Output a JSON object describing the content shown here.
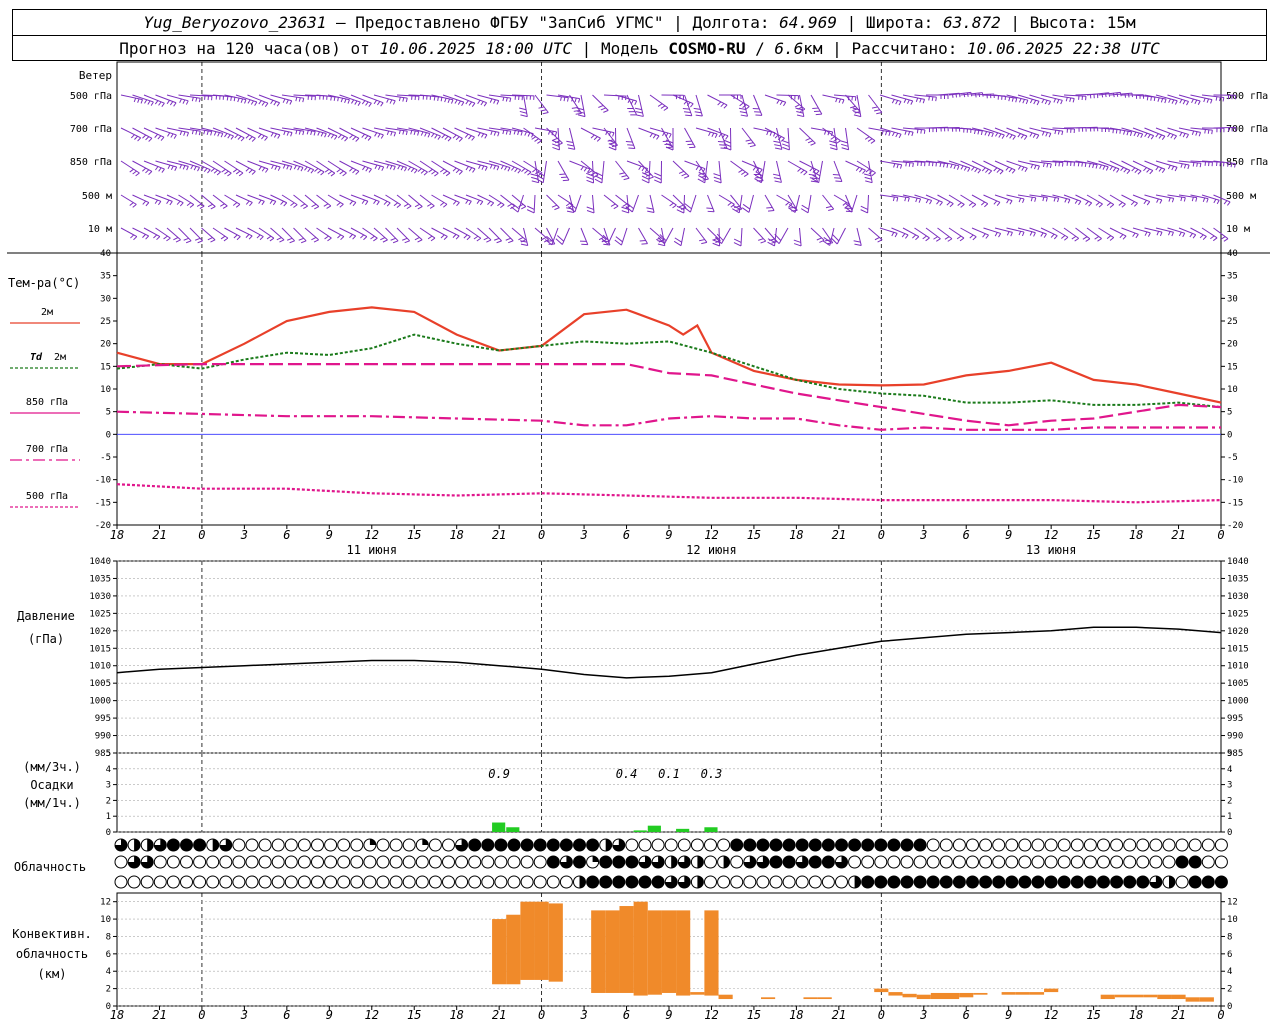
{
  "header": {
    "station": "Yug_Beryozovo_23631",
    "dash": " – ",
    "provider": "Предоставлено ФГБУ \"ЗапСиб УГМС\"",
    "lon_label": "Долгота:",
    "lon_value": "64.969",
    "lat_label": "Широта:",
    "lat_value": "63.872",
    "alt_label": "Высота:",
    "alt_value": "15м",
    "forecast_prefix": "Прогноз на 120 часа(ов) от",
    "forecast_time": "10.06.2025 18:00 UTC",
    "model_label": "Модель",
    "model_name": "COSMO-RU",
    "model_res": "6.6",
    "model_res_unit": "км",
    "calc_label": "Рассчитано:",
    "calc_time": "10.06.2025 22:38 UTC"
  },
  "time_axis": {
    "tick_labels": [
      "18",
      "21",
      "0",
      "3",
      "6",
      "9",
      "12",
      "15",
      "18",
      "21",
      "0",
      "3",
      "6",
      "9",
      "12",
      "15",
      "18",
      "21",
      "0",
      "3",
      "6",
      "9",
      "12",
      "15",
      "18",
      "21",
      "0"
    ],
    "day_labels": [
      {
        "text": "11 июня",
        "hour": 18
      },
      {
        "text": "12 июня",
        "hour": 42
      },
      {
        "text": "13 июня",
        "hour": 66
      }
    ],
    "midnight_hours": [
      6,
      30,
      54
    ]
  },
  "wind_panel": {
    "title": "Ветер",
    "levels": [
      "500 гПа",
      "700 гПа",
      "850 гПа",
      "500 м",
      "10  м"
    ]
  },
  "temp_panel": {
    "title": "Тем-ра(°C)",
    "legend": [
      {
        "label": "2м",
        "color": "#e8402a",
        "dash": ""
      },
      {
        "label": "2м",
        "prefix": "Td",
        "color": "#1a7a1a",
        "dash": "3,2"
      },
      {
        "label": "850 гПа",
        "color": "#e0168c",
        "dash": ""
      },
      {
        "label": "700 гПа",
        "color": "#e0168c",
        "dash": "12,4,3,4"
      },
      {
        "label": "500 гПа",
        "color": "#e0168c",
        "dash": "3,2"
      }
    ],
    "yticks": [
      "40",
      "35",
      "30",
      "25",
      "20",
      "15",
      "10",
      "5",
      "0",
      "-5",
      "-10",
      "-15",
      "-20"
    ]
  },
  "pressure_panel": {
    "title": "Давление",
    "unit": "(гПа)",
    "yticks": [
      "1040",
      "1035",
      "1030",
      "1025",
      "1020",
      "1015",
      "1010",
      "1005",
      "1000",
      "995",
      "990",
      "985"
    ]
  },
  "precip_panel": {
    "unit3": "(мм/3ч.)",
    "title": "Осадки",
    "unit1": "(мм/1ч.)",
    "yticks": [
      "5",
      "4",
      "3",
      "2",
      "1",
      "0"
    ],
    "annotations": [
      {
        "text": "0.9",
        "hour": 27
      },
      {
        "text": "0.4",
        "hour": 36
      },
      {
        "text": "0.1",
        "hour": 39
      },
      {
        "text": "0.3",
        "hour": 42
      }
    ]
  },
  "cloud_panel": {
    "title": "Облачность"
  },
  "conv_panel": {
    "title1": "Конвективн.",
    "title2": "облачность",
    "unit": "(км)",
    "yticks": [
      "12",
      "10",
      "8",
      "6",
      "4",
      "2",
      "0"
    ]
  },
  "chart_data": {
    "type": "line",
    "x_unit": "hours since 10.06.2025 18:00 UTC",
    "x_range": [
      0,
      78
    ],
    "temperature": {
      "ylim": [
        -20,
        40
      ],
      "series": [
        {
          "name": "2м",
          "x": [
            0,
            3,
            6,
            9,
            12,
            15,
            18,
            21,
            24,
            27,
            30,
            33,
            36,
            39,
            40,
            41,
            42,
            45,
            48,
            51,
            54,
            57,
            60,
            63,
            66,
            69,
            72,
            75,
            78
          ],
          "values": [
            18,
            15.5,
            15.5,
            20,
            25,
            27,
            28,
            27,
            22,
            18.5,
            19.5,
            26.5,
            27.5,
            24,
            22,
            24,
            18,
            14,
            12,
            11,
            10.8,
            11,
            13,
            14,
            15.8,
            12,
            11,
            9,
            7
          ]
        },
        {
          "name": "Td 2м",
          "x": [
            0,
            3,
            6,
            9,
            12,
            15,
            18,
            21,
            24,
            27,
            30,
            33,
            36,
            39,
            42,
            45,
            48,
            51,
            54,
            57,
            60,
            63,
            66,
            69,
            72,
            75,
            78
          ],
          "values": [
            14.5,
            15.5,
            14.5,
            16.5,
            18,
            17.5,
            19,
            22,
            20,
            18.5,
            19.5,
            20.5,
            20,
            20.5,
            18,
            15,
            12,
            10,
            9,
            8.5,
            7,
            7,
            7.5,
            6.5,
            6.5,
            7,
            6
          ]
        },
        {
          "name": "850 гПа",
          "x": [
            0,
            6,
            12,
            18,
            24,
            30,
            36,
            39,
            42,
            45,
            48,
            51,
            54,
            57,
            60,
            63,
            66,
            69,
            72,
            75,
            78
          ],
          "values": [
            15,
            15.5,
            15.5,
            15.5,
            15.5,
            15.5,
            15.5,
            13.5,
            13,
            11,
            9,
            7.5,
            6,
            4.5,
            3,
            2,
            3,
            3.5,
            5,
            6.5,
            6
          ]
        },
        {
          "name": "700 гПа",
          "x": [
            0,
            6,
            12,
            18,
            24,
            30,
            33,
            36,
            39,
            42,
            45,
            48,
            51,
            54,
            57,
            60,
            63,
            66,
            69,
            72,
            75,
            78
          ],
          "values": [
            5,
            4.5,
            4,
            4,
            3.5,
            3,
            2,
            2,
            3.5,
            4,
            3.5,
            3.5,
            2,
            1,
            1.5,
            1,
            1,
            1,
            1.5,
            1.5,
            1.5,
            1.5
          ]
        },
        {
          "name": "500 гПа",
          "x": [
            0,
            6,
            12,
            18,
            24,
            30,
            36,
            42,
            48,
            54,
            60,
            66,
            72,
            78
          ],
          "values": [
            -11,
            -12,
            -12,
            -13,
            -13.5,
            -13,
            -13.5,
            -14,
            -14,
            -14.5,
            -14.5,
            -14.5,
            -15,
            -14.5
          ]
        }
      ]
    },
    "pressure": {
      "ylim": [
        985,
        1040
      ],
      "x": [
        0,
        3,
        6,
        9,
        12,
        15,
        18,
        21,
        24,
        27,
        30,
        33,
        36,
        39,
        42,
        45,
        48,
        51,
        54,
        57,
        60,
        63,
        66,
        69,
        72,
        75,
        78
      ],
      "values": [
        1008,
        1009,
        1009.5,
        1010,
        1010.5,
        1011,
        1011.5,
        1011.5,
        1011,
        1010,
        1009,
        1007.5,
        1006.5,
        1007,
        1008,
        1010.5,
        1013,
        1015,
        1017,
        1018,
        1019,
        1019.5,
        1020,
        1021,
        1021,
        1020.5,
        1019.5
      ]
    },
    "precipitation": {
      "ylim": [
        0,
        5
      ],
      "bars": [
        {
          "hour": 27,
          "value": 0.6
        },
        {
          "hour": 28,
          "value": 0.3
        },
        {
          "hour": 37,
          "value": 0.1
        },
        {
          "hour": 38,
          "value": 0.4
        },
        {
          "hour": 40,
          "value": 0.2
        },
        {
          "hour": 42,
          "value": 0.3
        }
      ]
    },
    "cloudiness": {
      "rows": [
        [
          3,
          2,
          2,
          3,
          4,
          4,
          4,
          2,
          3,
          0,
          0,
          0,
          0,
          0,
          0,
          0,
          0,
          0,
          0,
          1,
          0,
          0,
          0,
          1,
          0,
          0,
          3,
          4,
          4,
          4,
          4,
          4,
          4,
          4,
          4,
          4,
          4,
          2,
          3,
          0,
          0,
          0,
          0,
          0,
          0,
          0,
          0,
          4,
          4,
          4,
          4,
          4,
          4,
          4,
          4,
          4,
          4,
          4,
          4,
          4,
          4,
          4,
          0,
          0,
          0,
          0,
          0,
          0,
          0,
          0,
          0,
          0,
          0,
          0,
          0,
          0,
          0,
          0,
          0,
          0,
          0,
          0,
          0,
          0,
          0,
          0,
          0,
          0
        ],
        [
          0,
          3,
          3,
          0,
          0,
          0,
          0,
          0,
          0,
          0,
          0,
          0,
          0,
          0,
          0,
          0,
          0,
          0,
          0,
          0,
          0,
          0,
          0,
          0,
          0,
          0,
          0,
          0,
          0,
          0,
          0,
          0,
          0,
          4,
          3,
          4,
          1,
          4,
          4,
          4,
          3,
          3,
          2,
          3,
          2,
          0,
          2,
          0,
          3,
          3,
          4,
          4,
          3,
          4,
          4,
          3,
          0,
          0,
          0,
          0,
          0,
          0,
          0,
          0,
          0,
          0,
          0,
          0,
          0,
          0,
          0,
          0,
          0,
          0,
          0,
          0,
          0,
          0,
          0,
          0,
          0,
          4,
          4,
          0,
          0,
          0,
          0,
          0
        ],
        [
          0,
          0,
          0,
          0,
          0,
          0,
          0,
          0,
          0,
          0,
          0,
          0,
          0,
          0,
          0,
          0,
          0,
          0,
          0,
          0,
          0,
          0,
          0,
          0,
          0,
          0,
          0,
          0,
          0,
          0,
          0,
          0,
          0,
          0,
          0,
          2,
          4,
          4,
          4,
          4,
          4,
          4,
          3,
          3,
          2,
          0,
          0,
          0,
          0,
          0,
          0,
          0,
          0,
          0,
          0,
          0,
          2,
          4,
          4,
          4,
          4,
          4,
          4,
          4,
          4,
          4,
          4,
          4,
          4,
          4,
          4,
          4,
          4,
          4,
          4,
          4,
          4,
          4,
          4,
          3,
          2,
          0,
          4,
          4,
          4,
          4,
          4,
          4
        ]
      ]
    },
    "convective_cloud": {
      "ylim": [
        0,
        13
      ],
      "bars": [
        {
          "hour": 27,
          "base": 2.5,
          "top": 10
        },
        {
          "hour": 28,
          "base": 2.5,
          "top": 10.5
        },
        {
          "hour": 29,
          "base": 3,
          "top": 12
        },
        {
          "hour": 30,
          "base": 3,
          "top": 12
        },
        {
          "hour": 31,
          "base": 2.8,
          "top": 11.8
        },
        {
          "hour": 34,
          "base": 1.5,
          "top": 11
        },
        {
          "hour": 35,
          "base": 1.5,
          "top": 11
        },
        {
          "hour": 36,
          "base": 1.5,
          "top": 11.5
        },
        {
          "hour": 37,
          "base": 1.2,
          "top": 12
        },
        {
          "hour": 38,
          "base": 1.3,
          "top": 11
        },
        {
          "hour": 39,
          "base": 1.5,
          "top": 11
        },
        {
          "hour": 40,
          "base": 1.2,
          "top": 11
        },
        {
          "hour": 41,
          "base": 1.3,
          "top": 1.6
        },
        {
          "hour": 42,
          "base": 1.2,
          "top": 11
        },
        {
          "hour": 43,
          "base": 0.8,
          "top": 1.3
        },
        {
          "hour": 46,
          "base": 0.8,
          "top": 1
        },
        {
          "hour": 49,
          "base": 0.8,
          "top": 1
        },
        {
          "hour": 50,
          "base": 0.8,
          "top": 1
        },
        {
          "hour": 54,
          "base": 1.6,
          "top": 2
        },
        {
          "hour": 55,
          "base": 1.2,
          "top": 1.6
        },
        {
          "hour": 56,
          "base": 1,
          "top": 1.4
        },
        {
          "hour": 57,
          "base": 0.8,
          "top": 1.3
        },
        {
          "hour": 58,
          "base": 0.8,
          "top": 1.5
        },
        {
          "hour": 59,
          "base": 0.8,
          "top": 1.5
        },
        {
          "hour": 60,
          "base": 1,
          "top": 1.5
        },
        {
          "hour": 61,
          "base": 1.3,
          "top": 1.5
        },
        {
          "hour": 63,
          "base": 1.3,
          "top": 1.6
        },
        {
          "hour": 64,
          "base": 1.3,
          "top": 1.6
        },
        {
          "hour": 65,
          "base": 1.3,
          "top": 1.6
        },
        {
          "hour": 66,
          "base": 1.6,
          "top": 2
        },
        {
          "hour": 70,
          "base": 0.8,
          "top": 1.3
        },
        {
          "hour": 71,
          "base": 1,
          "top": 1.3
        },
        {
          "hour": 72,
          "base": 1,
          "top": 1.3
        },
        {
          "hour": 73,
          "base": 1,
          "top": 1.3
        },
        {
          "hour": 74,
          "base": 0.8,
          "top": 1.3
        },
        {
          "hour": 75,
          "base": 0.8,
          "top": 1.3
        },
        {
          "hour": 76,
          "base": 0.5,
          "top": 1
        },
        {
          "hour": 77,
          "base": 0.5,
          "top": 1
        }
      ]
    }
  },
  "colors": {
    "wind": "#7b2fbe",
    "t2m": "#e8402a",
    "td": "#1a7a1a",
    "upper": "#e0168c",
    "precip": "#22cc22",
    "conv": "#f08a2a",
    "zero_line": "#3333ff"
  }
}
